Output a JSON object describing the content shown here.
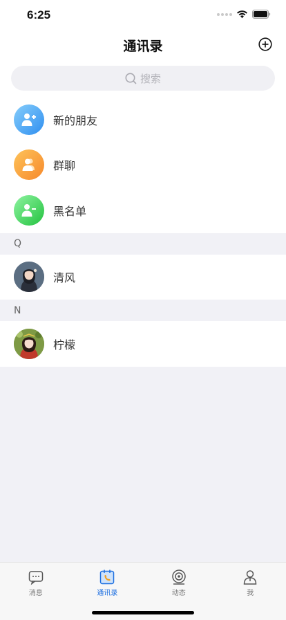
{
  "status_bar": {
    "time": "6:25"
  },
  "nav": {
    "title": "通讯录"
  },
  "search": {
    "placeholder": "搜索"
  },
  "functions": [
    {
      "label": "新的朋友",
      "icon": "add-friend-icon",
      "color_from": "#86cdfb",
      "color_to": "#2f8ff0"
    },
    {
      "label": "群聊",
      "icon": "group-chat-icon",
      "color_from": "#fdc35a",
      "color_to": "#f7892c"
    },
    {
      "label": "黑名单",
      "icon": "blacklist-icon",
      "color_from": "#8ef3a0",
      "color_to": "#23c23f"
    }
  ],
  "sections": [
    {
      "letter": "Q",
      "contacts": [
        {
          "name": "清风"
        }
      ]
    },
    {
      "letter": "N",
      "contacts": [
        {
          "name": "柠檬"
        }
      ]
    }
  ],
  "tab_bar": {
    "tabs": [
      {
        "label": "消息",
        "icon": "message-icon",
        "active": false
      },
      {
        "label": "通讯录",
        "icon": "contacts-icon",
        "active": true
      },
      {
        "label": "动态",
        "icon": "moments-icon",
        "active": false
      },
      {
        "label": "我",
        "icon": "profile-icon",
        "active": false
      }
    ],
    "active_color": "#1d6fe0"
  }
}
